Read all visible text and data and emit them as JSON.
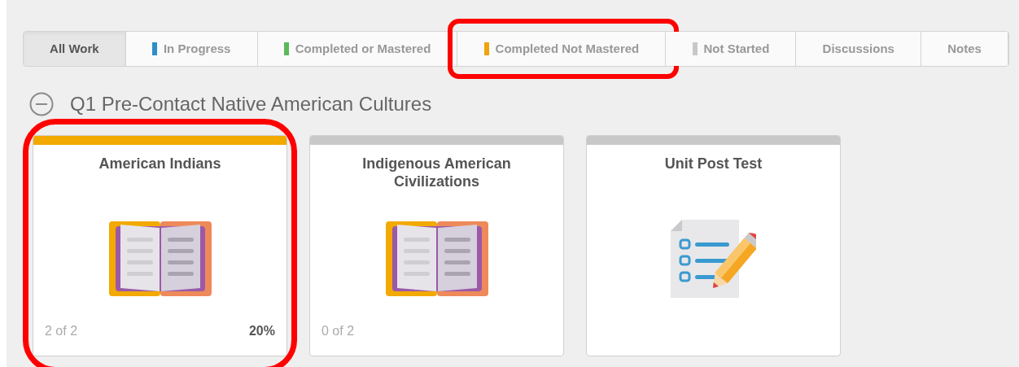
{
  "tabs": [
    {
      "label": "All Work",
      "selected": true,
      "highlighted": false
    },
    {
      "label": "In Progress",
      "selected": false,
      "color": "#2e8fc9",
      "highlighted": false
    },
    {
      "label": "Completed or Mastered",
      "selected": false,
      "color": "#5cb85c",
      "highlighted": false
    },
    {
      "label": "Completed Not Mastered",
      "selected": false,
      "color": "#f0a30a",
      "highlighted": true
    },
    {
      "label": "Not Started",
      "selected": false,
      "color": "#c8c8c8",
      "highlighted": false
    },
    {
      "label": "Discussions",
      "selected": false,
      "highlighted": false
    },
    {
      "label": "Notes",
      "selected": false,
      "highlighted": false
    }
  ],
  "section": {
    "title": "Q1 Pre-Contact Native American Cultures",
    "expanded": true
  },
  "cards": [
    {
      "title": "American Indians",
      "kind": "book",
      "color": "#f2a900",
      "progress": "2 of 2",
      "score": "20%",
      "highlighted": true
    },
    {
      "title": "Indigenous American Civilizations",
      "kind": "book",
      "color": "#c8c8c8",
      "progress": "0 of 2",
      "highlighted": false
    },
    {
      "title": "Unit Post Test",
      "kind": "test",
      "color": "#c8c8c8",
      "highlighted": false
    }
  ]
}
